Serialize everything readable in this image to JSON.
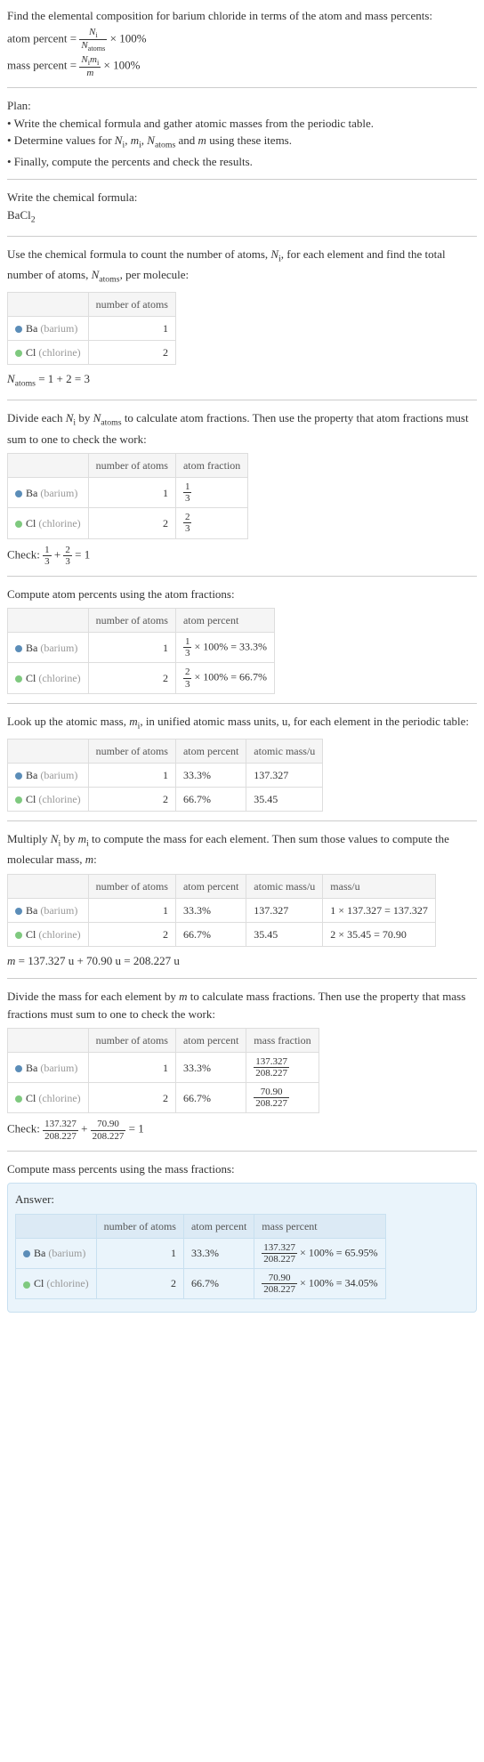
{
  "intro": {
    "line1": "Find the elemental composition for barium chloride in terms of the atom and mass percents:",
    "atom_percent_formula": "atom percent = ",
    "mass_percent_formula": "mass percent = ",
    "frac_Ni": "N",
    "frac_Ni_sub": "i",
    "frac_Natoms": "N",
    "frac_Natoms_sub": "atoms",
    "frac_Nimi": "N",
    "frac_Nimi_i": "i",
    "frac_Nimi_m": "m",
    "frac_Nimi_mi": "i",
    "frac_m": "m",
    "times100": " × 100%"
  },
  "plan": {
    "heading": "Plan:",
    "b1": "• Write the chemical formula and gather atomic masses from the periodic table.",
    "b2_a": "• Determine values for ",
    "b2_b": " and ",
    "b2_c": " using these items.",
    "b3": "• Finally, compute the percents and check the results."
  },
  "formula_section": {
    "heading": "Write the chemical formula:",
    "formula": "BaCl",
    "formula_sub": "2"
  },
  "count_section": {
    "text_a": "Use the chemical formula to count the number of atoms, ",
    "text_b": ", for each element and find the total number of atoms, ",
    "text_c": ", per molecule:",
    "Natoms_eq": " = 1 + 2 = 3"
  },
  "headers": {
    "num_atoms": "number of atoms",
    "atom_frac": "atom fraction",
    "atom_pct": "atom percent",
    "atomic_mass": "atomic mass/u",
    "massu": "mass/u",
    "mass_frac": "mass fraction",
    "mass_pct": "mass percent"
  },
  "elements": {
    "ba_name": "Ba",
    "ba_paren": " (barium)",
    "cl_name": "Cl",
    "cl_paren": " (chlorine)"
  },
  "counts": {
    "ba": "1",
    "cl": "2"
  },
  "atom_frac_section": {
    "text_a": "Divide each ",
    "text_b": " by ",
    "text_c": " to calculate atom fractions. Then use the property that atom fractions must sum to one to check the work:",
    "ba_frac_n": "1",
    "ba_frac_d": "3",
    "cl_frac_n": "2",
    "cl_frac_d": "3",
    "check_a": "Check: ",
    "check_b": " + ",
    "check_c": " = 1"
  },
  "atom_pct_section": {
    "text": "Compute atom percents using the atom fractions:",
    "ba_calc": " × 100% = 33.3%",
    "cl_calc": " × 100% = 66.7%"
  },
  "atom_pct_vals": {
    "ba": "33.3%",
    "cl": "66.7%"
  },
  "mass_lookup_section": {
    "text_a": "Look up the atomic mass, ",
    "text_b": ", in unified atomic mass units, u, for each element in the periodic table:",
    "ba_mass": "137.327",
    "cl_mass": "35.45"
  },
  "mass_calc_section": {
    "text_a": "Multiply ",
    "text_b": " by ",
    "text_c": " to compute the mass for each element. Then sum those values to compute the molecular mass, ",
    "text_d": ":",
    "ba_calc": "1 × 137.327 = 137.327",
    "cl_calc": "2 × 35.45 = 70.90",
    "m_eq": " = 137.327 u + 70.90 u = 208.227 u"
  },
  "mass_frac_section": {
    "text_a": "Divide the mass for each element by ",
    "text_b": " to calculate mass fractions. Then use the property that mass fractions must sum to one to check the work:",
    "ba_n": "137.327",
    "ba_d": "208.227",
    "cl_n": "70.90",
    "cl_d": "208.227",
    "check_a": "Check: ",
    "check_b": " + ",
    "check_c": " = 1"
  },
  "mass_pct_section": {
    "text": "Compute mass percents using the mass fractions:"
  },
  "answer": {
    "label": "Answer:",
    "ba_calc": " × 100% = 65.95%",
    "cl_calc": " × 100% = 34.05%"
  },
  "symbols": {
    "N": "N",
    "i": "i",
    "atoms": "atoms",
    "m": "m"
  },
  "chart_data": {
    "type": "table",
    "title": "Elemental composition of barium chloride (BaCl2)",
    "molecular_mass_u": 208.227,
    "total_atoms": 3,
    "rows": [
      {
        "element": "Ba",
        "name": "barium",
        "number_of_atoms": 1,
        "atom_fraction": "1/3",
        "atom_percent": 33.3,
        "atomic_mass_u": 137.327,
        "mass_u": 137.327,
        "mass_fraction": "137.327/208.227",
        "mass_percent": 65.95
      },
      {
        "element": "Cl",
        "name": "chlorine",
        "number_of_atoms": 2,
        "atom_fraction": "2/3",
        "atom_percent": 66.7,
        "atomic_mass_u": 35.45,
        "mass_u": 70.9,
        "mass_fraction": "70.90/208.227",
        "mass_percent": 34.05
      }
    ]
  }
}
